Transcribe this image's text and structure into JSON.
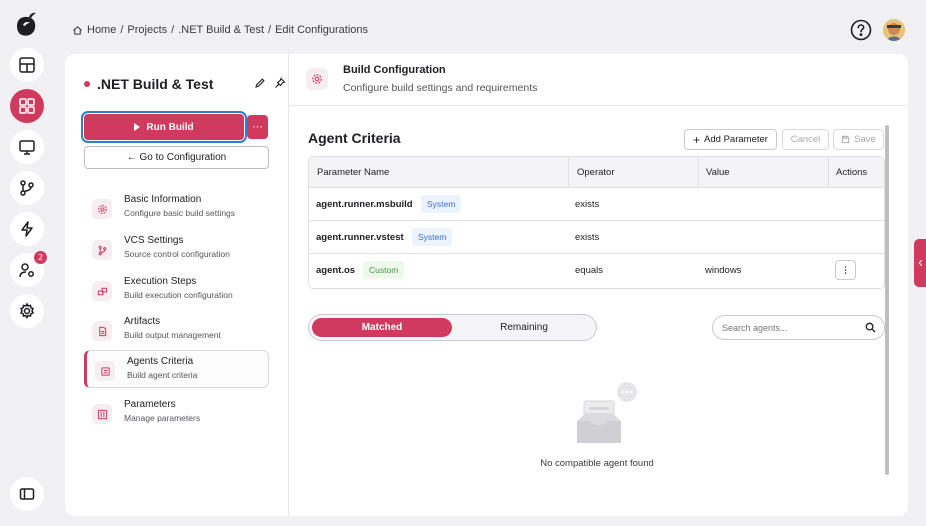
{
  "breadcrumb": {
    "home": "Home",
    "separator": "/",
    "items": [
      "Projects",
      ".NET Build & Test",
      "Edit Configurations"
    ]
  },
  "sidebar_rail": {
    "badge_count": "2",
    "icons": [
      "dashboard-icon",
      "projects-icon",
      "monitor-icon",
      "vcs-icon",
      "bolt-icon",
      "user-gear-icon",
      "settings-icon",
      "panel-toggle-icon"
    ]
  },
  "project": {
    "title": ".NET Build & Test",
    "run_label": "Run Build",
    "more_label": "···",
    "goto_label": "← Go to Configuration"
  },
  "nav": [
    {
      "title": "Basic Information",
      "subtitle": "Configure basic build settings"
    },
    {
      "title": "VCS Settings",
      "subtitle": "Source control configuration"
    },
    {
      "title": "Execution Steps",
      "subtitle": "Build execution configuration"
    },
    {
      "title": "Artifacts",
      "subtitle": "Build output management"
    },
    {
      "title": "Agents Criteria",
      "subtitle": "Build agent criteria"
    },
    {
      "title": "Parameters",
      "subtitle": "Manage parameters"
    }
  ],
  "header": {
    "title": "Build Configuration",
    "subtitle": "Configure build settings and requirements"
  },
  "agent_criteria": {
    "title": "Agent Criteria",
    "add_label": "Add Parameter",
    "cancel_label": "Cancel",
    "save_label": "Save",
    "columns": [
      "Parameter Name",
      "Operator",
      "Value",
      "Actions"
    ],
    "rows": [
      {
        "name": "agent.runner.msbuild",
        "tag": "System",
        "operator": "exists",
        "value": ""
      },
      {
        "name": "agent.runner.vstest",
        "tag": "System",
        "operator": "exists",
        "value": ""
      },
      {
        "name": "agent.os",
        "tag": "Custom",
        "operator": "equals",
        "value": "windows"
      }
    ]
  },
  "agents": {
    "matched_label": "Matched",
    "remaining_label": "Remaining",
    "search_placeholder": "Search agents...",
    "empty_text": "No compatible agent found"
  },
  "colors": {
    "accent": "#cf3a5e",
    "focus_outline": "#2d7fd6",
    "system_tag": "#3b6fd0",
    "custom_tag": "#3f9a3a"
  }
}
